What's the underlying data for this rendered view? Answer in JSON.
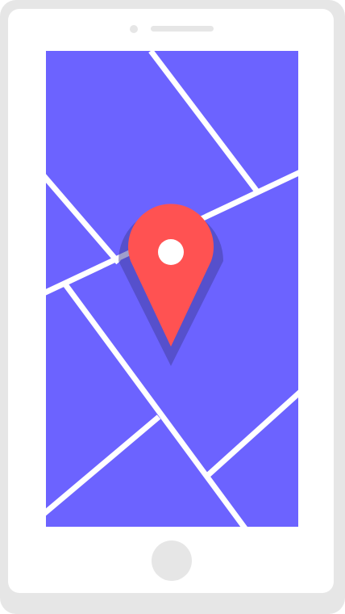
{
  "device": {
    "type": "smartphone"
  },
  "colors": {
    "frame": "#e6e6e6",
    "body": "#ffffff",
    "map": "#6c63ff",
    "roads": "#ffffff",
    "pin": "#ff5252",
    "pin_shadow": "#3f3d9a",
    "pin_dot": "#ffffff"
  },
  "icons": {
    "marker": "map-pin-icon"
  }
}
